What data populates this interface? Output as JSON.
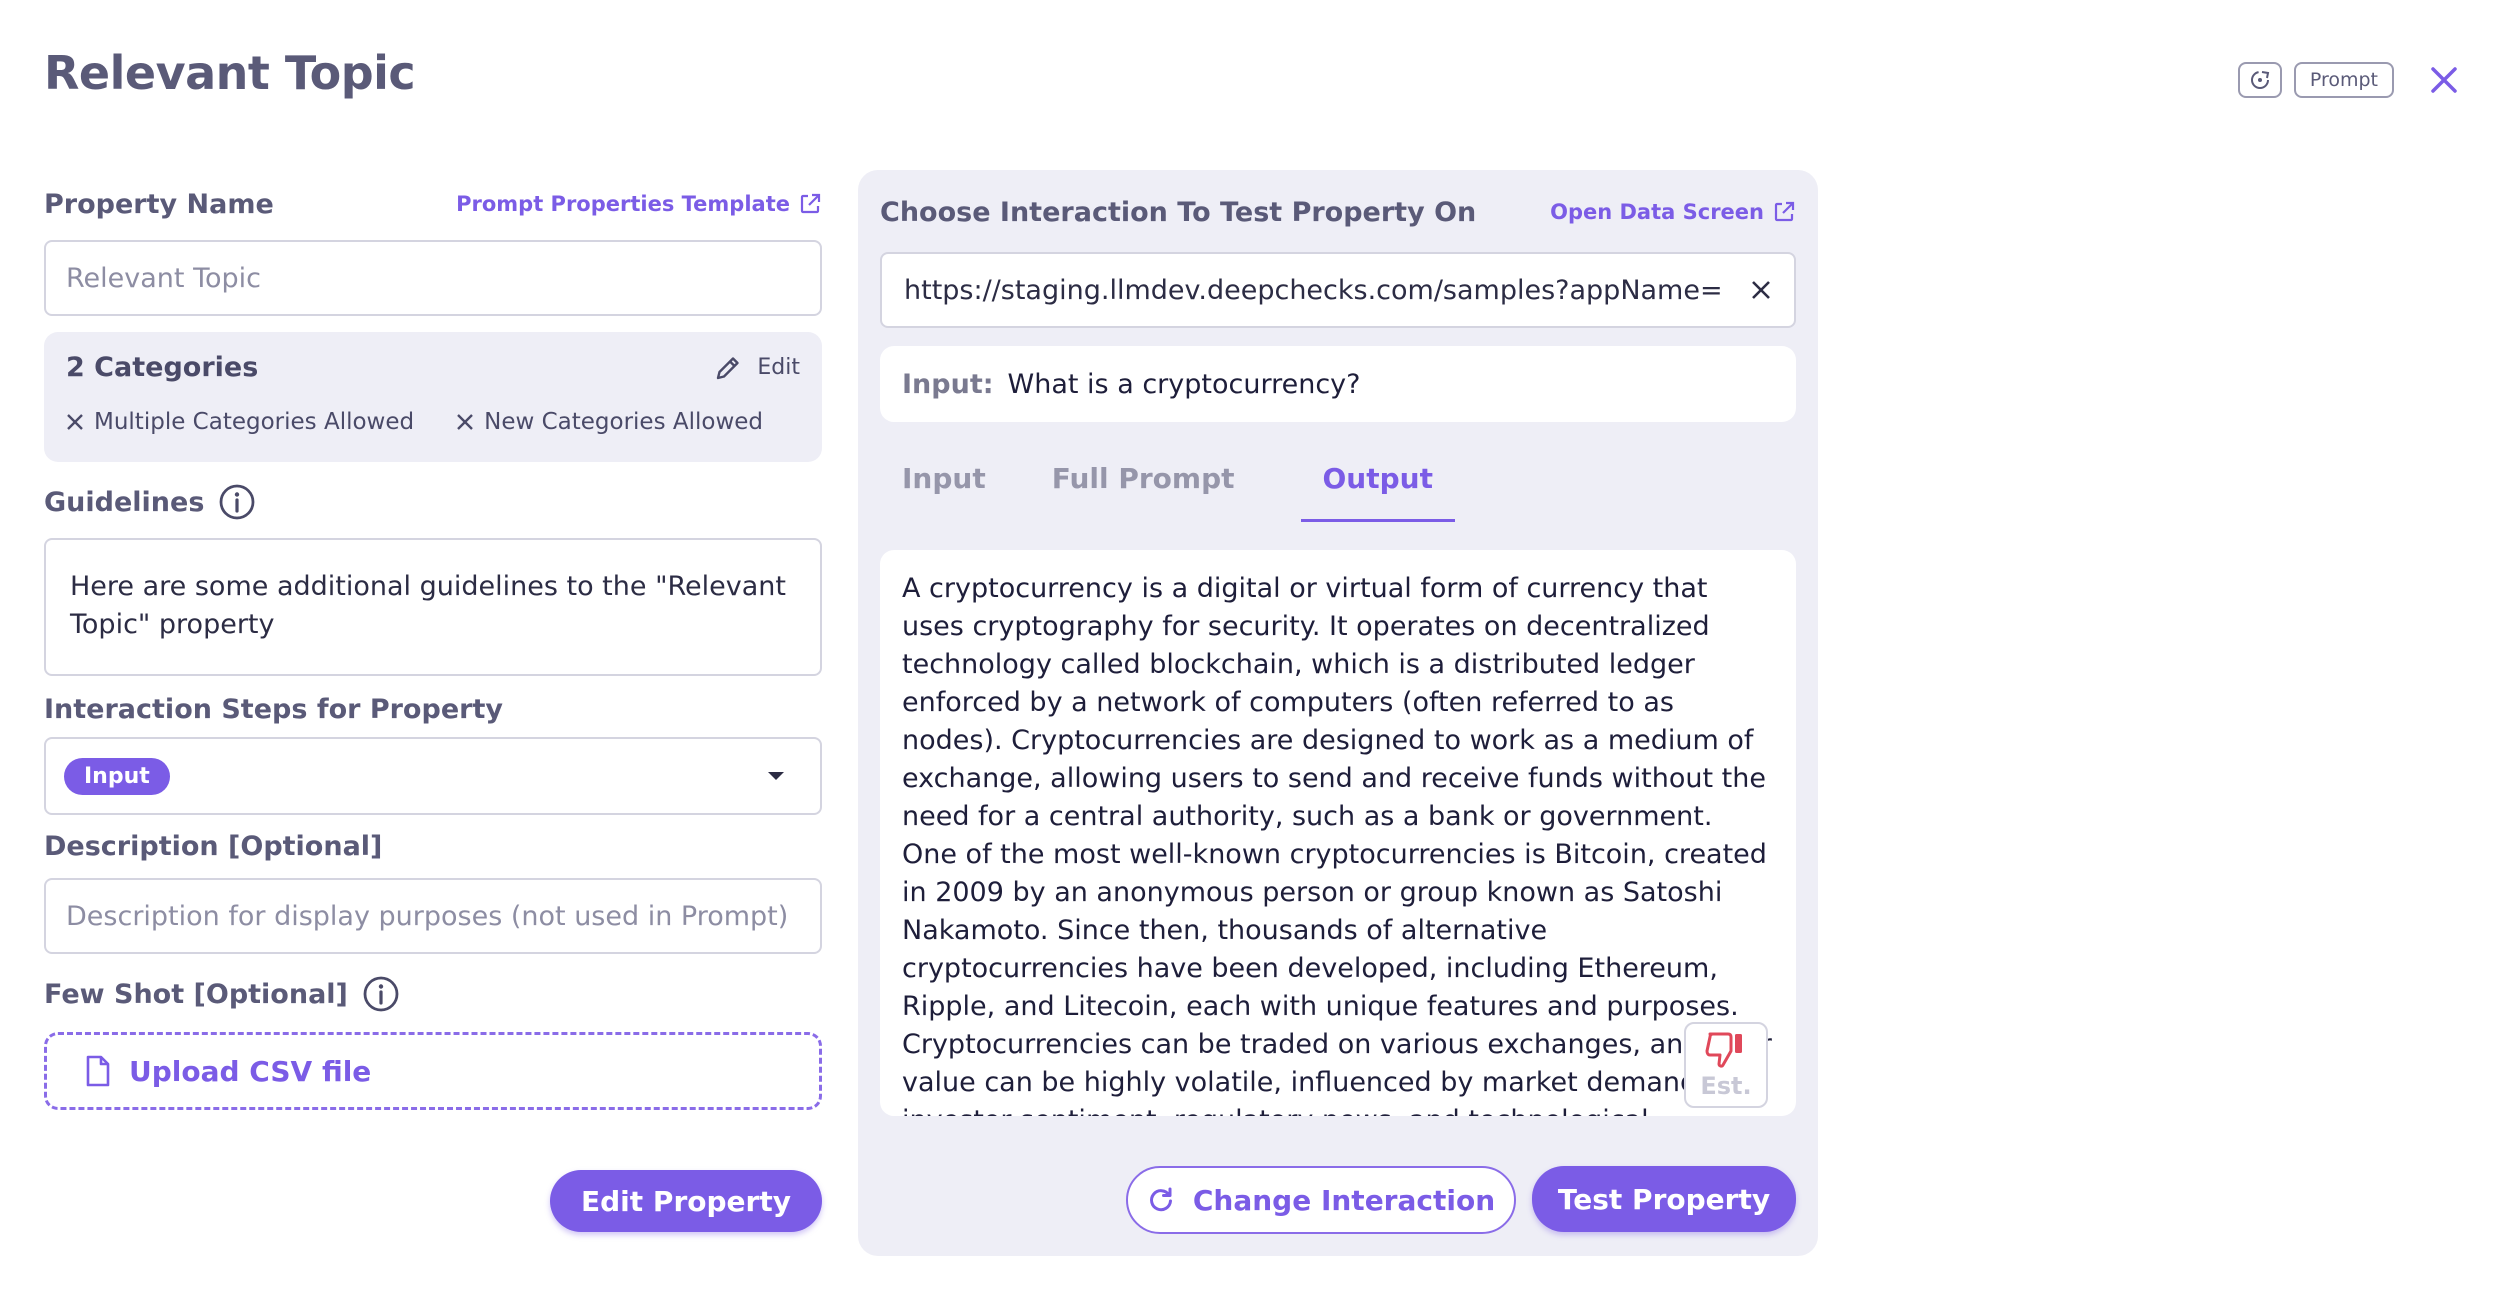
{
  "page": {
    "title": "Relevant Topic"
  },
  "top_right": {
    "prompt_label": "Prompt"
  },
  "left": {
    "property_name_label": "Property Name",
    "prompt_template_link": "Prompt Properties Template",
    "property_name_value": "Relevant Topic",
    "categories": {
      "title": "2 Categories",
      "edit_label": "Edit",
      "options": [
        "Multiple Categories Allowed",
        "New Categories Allowed"
      ]
    },
    "guidelines_label": "Guidelines",
    "guidelines_text": "Here are some additional guidelines to the \"Relevant Topic\" property",
    "interaction_steps_label": "Interaction Steps for Property",
    "interaction_steps_chip": "Input",
    "description_label": "Description [Optional]",
    "description_placeholder": "Description for display purposes (not used in Prompt)",
    "few_shot_label": "Few Shot [Optional]",
    "upload_label": "Upload CSV file",
    "edit_property_button": "Edit Property"
  },
  "right": {
    "choose_label": "Choose Interaction To Test Property On",
    "open_data_link": "Open Data Screen",
    "url_value": "https://staging.llmdev.deepchecks.com/samples?appName=Investment",
    "input_key": "Input:",
    "input_value": "What is a cryptocurrency?",
    "tabs": [
      "Input",
      "Full Prompt",
      "Output"
    ],
    "active_tab": "Output",
    "output_text": "A cryptocurrency is a digital or virtual form of currency that uses cryptography for security. It operates on decentralized technology called blockchain, which is a distributed ledger enforced by a network of computers (often referred to as nodes). Cryptocurrencies are designed to work as a medium of exchange, allowing users to send and receive funds without the need for a central authority, such as a bank or government. One of the most well-known cryptocurrencies is Bitcoin, created in 2009 by an anonymous person or group known as Satoshi Nakamoto. Since then, thousands of alternative cryptocurrencies have been developed, including Ethereum, Ripple, and Litecoin, each with unique features and purposes. Cryptocurrencies can be traded on various exchanges, and their value can be highly volatile, influenced by market demand, investor sentiment, regulatory news, and technological developments. Cryptocurrencies offer several advantages",
    "est_label": "Est.",
    "change_interaction_button": "Change Interaction",
    "test_property_button": "Test Property"
  },
  "colors": {
    "accent": "#7b5ce6",
    "panel_bg": "#eeeef6",
    "thumb_down": "#e0485a"
  }
}
